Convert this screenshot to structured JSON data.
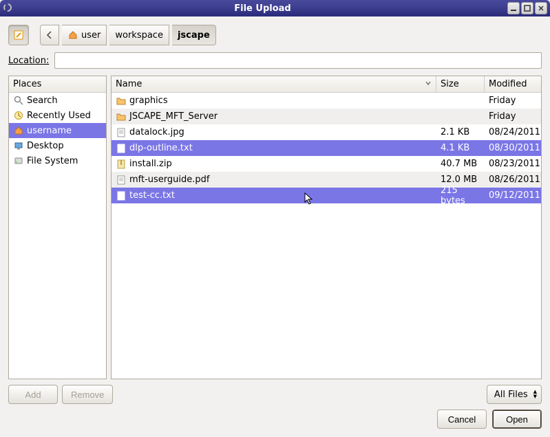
{
  "window": {
    "title": "File Upload"
  },
  "path": {
    "seg1": "user",
    "seg2": "workspace",
    "seg3": "jscape"
  },
  "location": {
    "label_text": "ocation:",
    "value": ""
  },
  "places": {
    "header": "Places",
    "items": [
      {
        "label": "Search",
        "icon": "search"
      },
      {
        "label": "Recently Used",
        "icon": "clock"
      },
      {
        "label": "username",
        "icon": "home"
      },
      {
        "label": "Desktop",
        "icon": "desktop"
      },
      {
        "label": "File System",
        "icon": "disk"
      }
    ]
  },
  "filelist": {
    "columns": {
      "name": "Name",
      "size": "Size",
      "modified": "Modified"
    },
    "rows": [
      {
        "name": "graphics",
        "size": "",
        "modified": "Friday",
        "icon": "folder",
        "alt": false,
        "selected": false
      },
      {
        "name": "JSCAPE_MFT_Server",
        "size": "",
        "modified": "Friday",
        "icon": "folder",
        "alt": true,
        "selected": false
      },
      {
        "name": "datalock.jpg",
        "size": "2.1 KB",
        "modified": "08/24/2011",
        "icon": "file",
        "alt": false,
        "selected": false
      },
      {
        "name": "dlp-outline.txt",
        "size": "4.1 KB",
        "modified": "08/30/2011",
        "icon": "file",
        "alt": true,
        "selected": true
      },
      {
        "name": "install.zip",
        "size": "40.7 MB",
        "modified": "08/23/2011",
        "icon": "zip",
        "alt": false,
        "selected": false
      },
      {
        "name": "mft-userguide.pdf",
        "size": "12.0 MB",
        "modified": "08/26/2011",
        "icon": "file",
        "alt": true,
        "selected": false
      },
      {
        "name": "test-cc.txt",
        "size": "215 bytes",
        "modified": "09/12/2011",
        "icon": "file",
        "alt": false,
        "selected": true
      }
    ]
  },
  "buttons": {
    "add": "Add",
    "remove": "Remove",
    "cancel": "Cancel",
    "open": "Open"
  },
  "filter": {
    "label": "All Files"
  }
}
